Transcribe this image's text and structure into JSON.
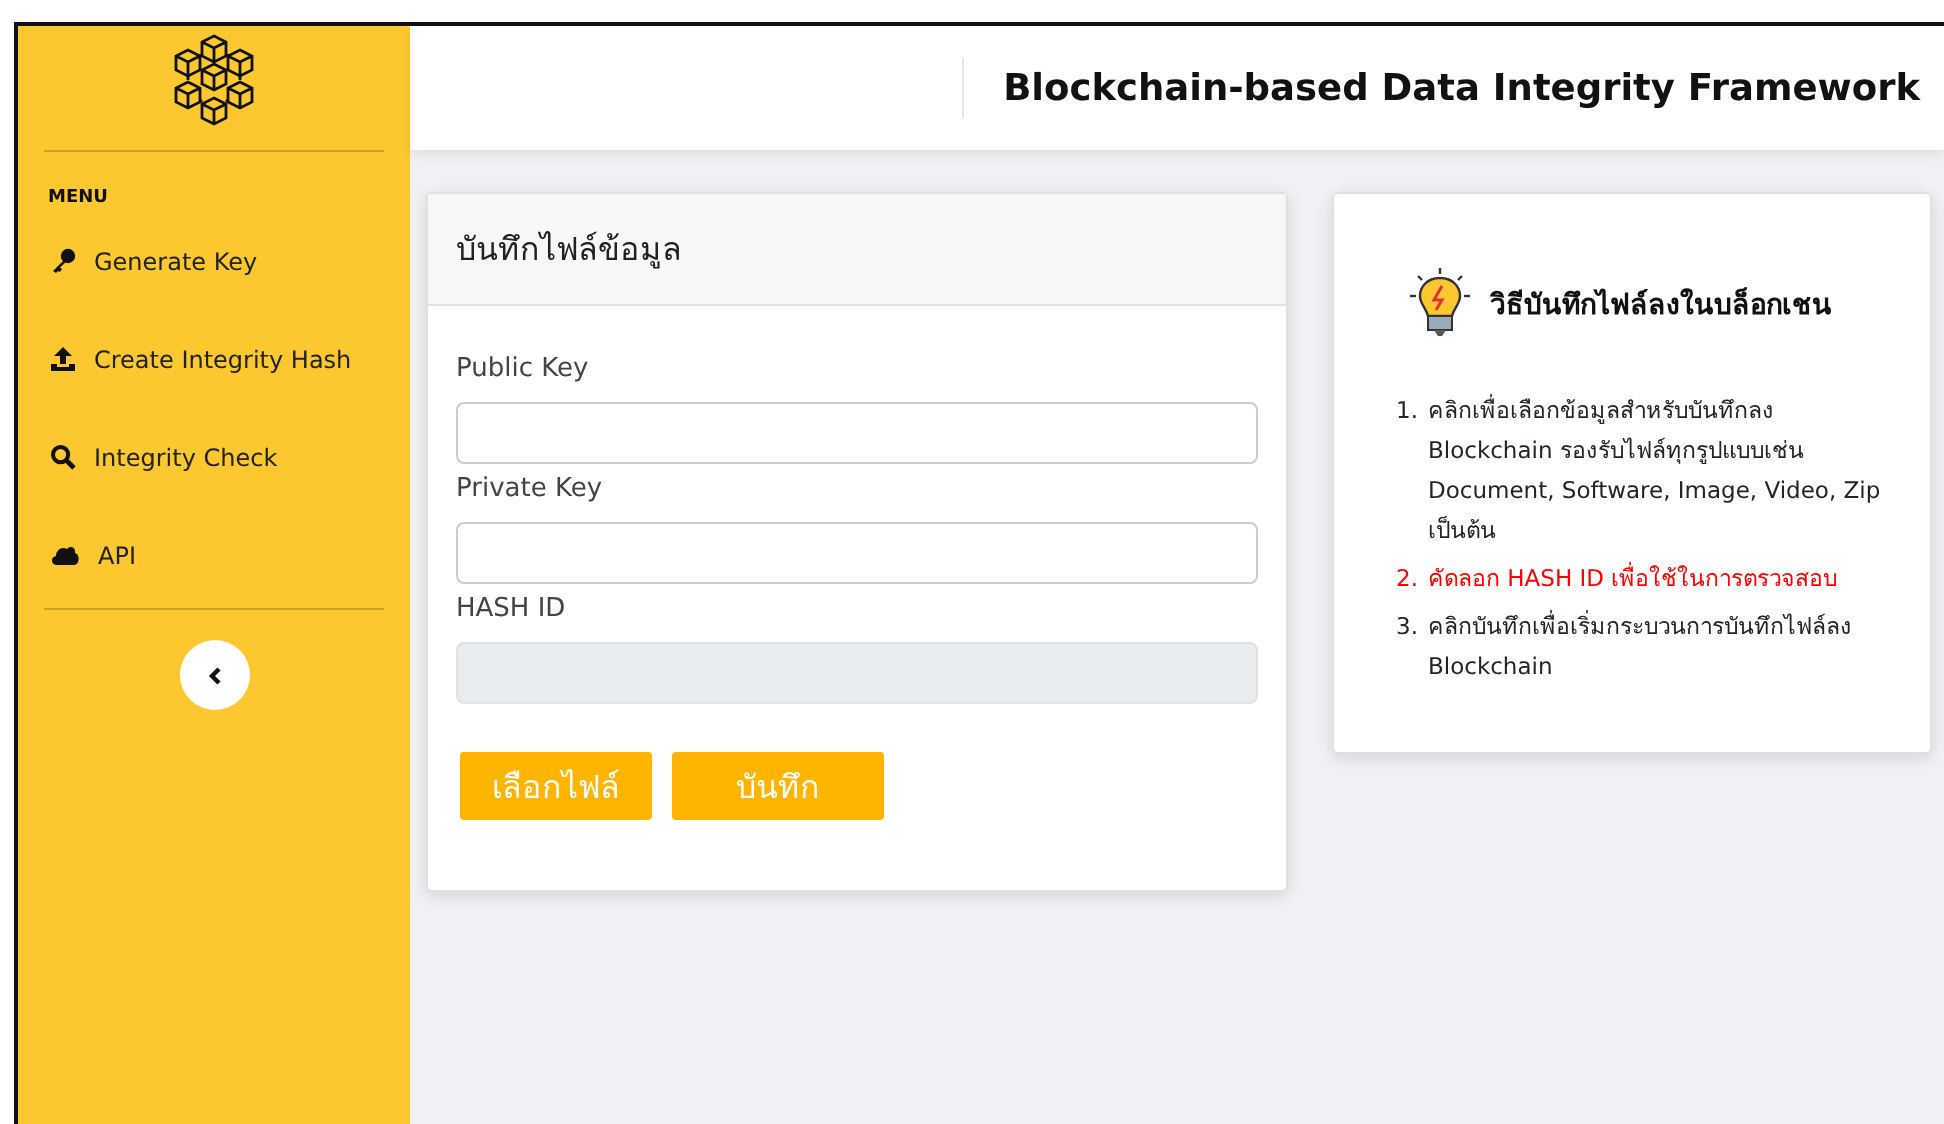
{
  "header": {
    "title": "Blockchain-based Data Integrity Framework"
  },
  "sidebar": {
    "heading": "MENU",
    "items": [
      {
        "label": "Generate Key"
      },
      {
        "label": "Create Integrity Hash"
      },
      {
        "label": "Integrity Check"
      },
      {
        "label": "API"
      }
    ]
  },
  "form": {
    "title": "บันทึกไฟล์ข้อมูล",
    "fields": [
      {
        "label": "Public Key",
        "disabled": false
      },
      {
        "label": "Private Key",
        "disabled": false
      },
      {
        "label": "HASH ID",
        "disabled": true
      }
    ],
    "buttons": [
      "เลือกไฟล์",
      "บันทึก"
    ]
  },
  "guide": {
    "title": "วิธีบันทึกไฟล์ลงในบล็อกเชน",
    "steps": [
      {
        "marker": "1.",
        "text": "คลิกเพื่อเลือกข้อมูลสำหรับบันทึกลง Blockchain รองรับไฟล์ทุกรูปแบบเช่น Document, Software, Image, Video, Zip เป็นต้น",
        "color": "#212529"
      },
      {
        "marker": "2.",
        "text": "คัดลอก HASH ID เพื่อใช้ในการตรวจสอบ",
        "color": "#ff0000"
      },
      {
        "marker": "3.",
        "text": "คลิกบันทึกเพื่อเริ่มกระบวนการบันทึกไฟล์ลง Blockchain",
        "color": "#212529"
      }
    ]
  }
}
